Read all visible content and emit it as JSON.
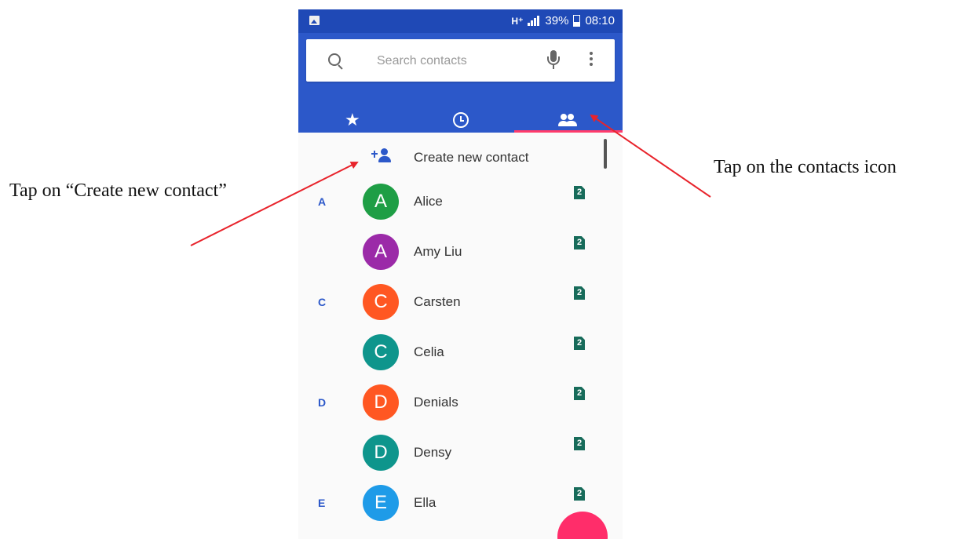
{
  "annotations": {
    "left": "Tap on “Create new contact”",
    "right": "Tap on the contacts icon"
  },
  "status_bar": {
    "network": "H⁺",
    "battery": "39%",
    "time": "08:10"
  },
  "search": {
    "placeholder": "Search contacts"
  },
  "tabs": [
    {
      "icon": "star-icon",
      "label": "Favorites"
    },
    {
      "icon": "clock-icon",
      "label": "Recents"
    },
    {
      "icon": "people-icon",
      "label": "Contacts",
      "active": true
    }
  ],
  "create_contact": {
    "label": "Create new contact"
  },
  "contacts": [
    {
      "section": "A",
      "initial": "A",
      "name": "Alice",
      "color": "#1e9e45"
    },
    {
      "section": "",
      "initial": "A",
      "name": "Amy Liu",
      "color": "#9b2aa8"
    },
    {
      "section": "C",
      "initial": "C",
      "name": "Carsten",
      "color": "#ff5722"
    },
    {
      "section": "",
      "initial": "C",
      "name": "Celia",
      "color": "#0e958c"
    },
    {
      "section": "D",
      "initial": "D",
      "name": "Denials",
      "color": "#ff5722"
    },
    {
      "section": "",
      "initial": "D",
      "name": "Densy",
      "color": "#0e958c"
    },
    {
      "section": "E",
      "initial": "E",
      "name": "Ella",
      "color": "#1e9be8"
    }
  ],
  "sim_label": "2",
  "colors": {
    "status_bar": "#1f49b6",
    "app_bar": "#2c58c9",
    "tab_indicator": "#ff3b6b",
    "fab": "#ff2d6a",
    "arrow": "#e8232b"
  }
}
